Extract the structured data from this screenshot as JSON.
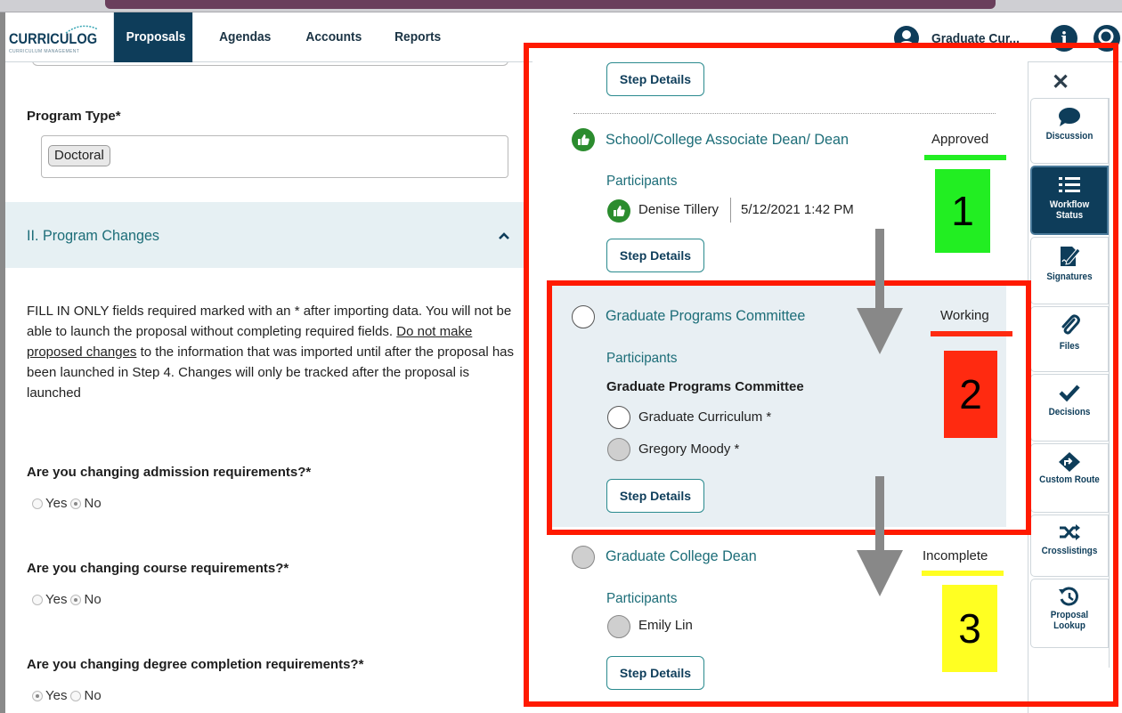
{
  "header": {
    "logo": "CURRICULOG",
    "logo_sub": "CURRICULUM MANAGEMENT",
    "nav": [
      "Proposals",
      "Agendas",
      "Accounts",
      "Reports"
    ],
    "user_name": "Graduate Cur...",
    "info_icon": "info-icon",
    "search_icon": "search-icon"
  },
  "form": {
    "program_type_label": "Program Type*",
    "program_type_value": "Doctoral",
    "section_title": "II. Program Changes",
    "instructions_part1": "FILL IN ONLY fields required marked with an * after importing data. You will not be able to launch the proposal without completing required fields. ",
    "instructions_underlined": "Do not make proposed changes",
    "instructions_part2": " to the information that was imported until after the proposal has been launched in Step 4. Changes will only be tracked after the proposal is launched",
    "questions": [
      {
        "label": "Are you changing admission requirements?*",
        "yes": "Yes",
        "no": "No",
        "selected": "No"
      },
      {
        "label": "Are you changing course requirements?*",
        "yes": "Yes",
        "no": "No",
        "selected": "No"
      },
      {
        "label": "Are you changing degree completion requirements?*",
        "yes": "Yes",
        "no": "No",
        "selected": "Yes"
      }
    ]
  },
  "workflow": {
    "step_details_label": "Step Details",
    "participants_label": "Participants",
    "steps": [
      {
        "title": "School/College Associate Dean/ Dean",
        "status": "Approved",
        "participants": [
          {
            "name": "Denise Tillery",
            "date": "5/12/2021 1:42 PM"
          }
        ]
      },
      {
        "title": "Graduate Programs Committee",
        "status": "Working",
        "group": "Graduate Programs Committee",
        "participants": [
          {
            "name": "Graduate Curriculum *"
          },
          {
            "name": "Gregory Moody *"
          }
        ]
      },
      {
        "title": "Graduate College Dean",
        "status": "Incomplete",
        "participants": [
          {
            "name": "Emily Lin"
          }
        ]
      }
    ]
  },
  "sidebar": {
    "close_icon": "close-icon",
    "items": [
      {
        "label": "Discussion",
        "icon": "chat-icon"
      },
      {
        "label": "Workflow Status",
        "icon": "list-icon",
        "active": true
      },
      {
        "label": "Signatures",
        "icon": "signature-icon"
      },
      {
        "label": "Files",
        "icon": "paperclip-icon"
      },
      {
        "label": "Decisions",
        "icon": "check-icon"
      },
      {
        "label": "Custom Route",
        "icon": "route-icon"
      },
      {
        "label": "Crosslistings",
        "icon": "shuffle-icon"
      },
      {
        "label": "Proposal Lookup",
        "icon": "history-icon"
      }
    ]
  },
  "annotations": {
    "numbers": [
      "1",
      "2",
      "3"
    ],
    "colors": {
      "frame": "#ff1a00",
      "one": "#22ee22",
      "two": "#ff2a10",
      "three": "#ffff22",
      "arrow": "#888888"
    }
  }
}
